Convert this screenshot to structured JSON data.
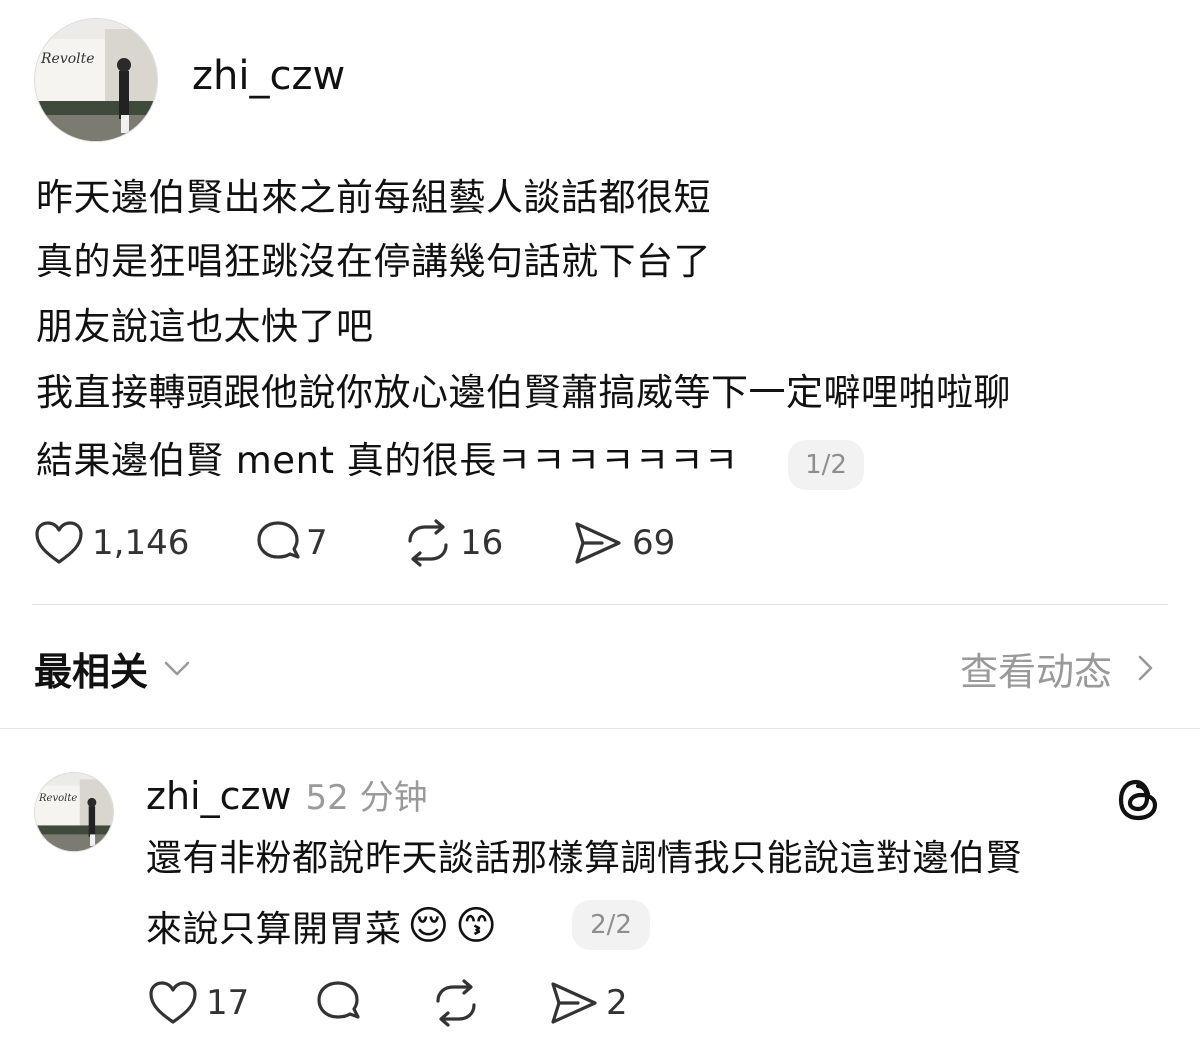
{
  "post": {
    "username": "zhi_czw",
    "avatar_text": "Revolte",
    "lines": [
      "昨天邊伯賢出來之前每組藝人談話都很短",
      "真的是狂唱狂跳沒在停講幾句話就下台了",
      "朋友說這也太快了吧",
      "我直接轉頭跟他說你放心邊伯賢蕭搞威等下一定噼哩啪啦聊",
      "結果邊伯賢 ment 真的很長ㅋㅋㅋㅋㅋㅋㅋ"
    ],
    "page_badge": "1/2",
    "likes": "1,146",
    "comments": "7",
    "reposts": "16",
    "shares": "69"
  },
  "sort": {
    "label": "最相关",
    "view_activity": "查看动态"
  },
  "reply": {
    "username": "zhi_czw",
    "avatar_text": "Revolte",
    "time": "52 分钟",
    "lines": [
      "還有非粉都說昨天談話那樣算調情我只能說這對邊伯賢",
      "來說只算開胃菜"
    ],
    "emojis": [
      "😌",
      "😙"
    ],
    "page_badge": "2/2",
    "likes": "17",
    "shares": "2"
  }
}
